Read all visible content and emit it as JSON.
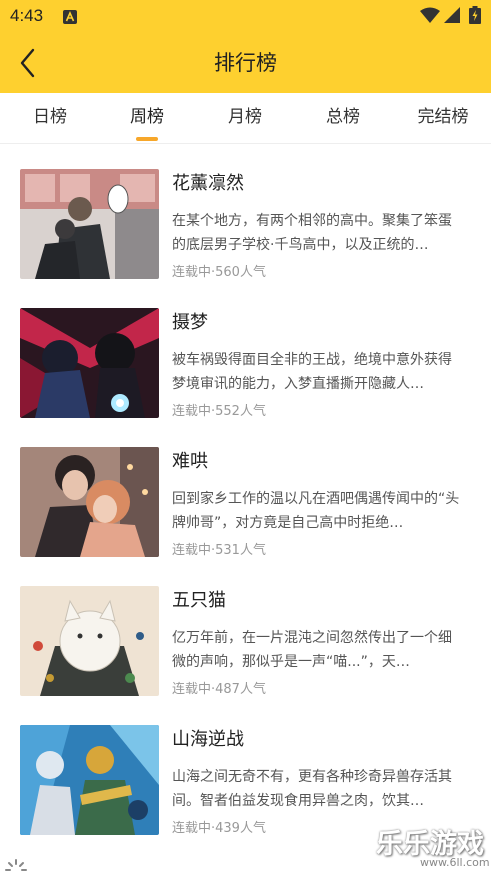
{
  "status_bar": {
    "time": "4:43"
  },
  "header": {
    "title": "排行榜"
  },
  "tabs": [
    {
      "label": "日榜"
    },
    {
      "label": "周榜"
    },
    {
      "label": "月榜"
    },
    {
      "label": "总榜"
    },
    {
      "label": "完结榜"
    }
  ],
  "active_tab": "周榜",
  "comics": [
    {
      "title": "花薰凛然",
      "desc": "在某个地方，有两个相邻的高中。聚集了笨蛋的底层男子学校·千鸟高中，以及正统的…",
      "meta": "连载中·560人气"
    },
    {
      "title": "摄梦",
      "desc": "被车祸毁得面目全非的王战，绝境中意外获得梦境审讯的能力，入梦直播撕开隐藏人…",
      "meta": "连载中·552人气"
    },
    {
      "title": "难哄",
      "desc": "回到家乡工作的温以凡在酒吧偶遇传闻中的“头牌帅哥”，对方竟是自己高中时拒绝…",
      "meta": "连载中·531人气"
    },
    {
      "title": "五只猫",
      "desc": "亿万年前，在一片混沌之间忽然传出了一个细微的声响，那似乎是一声“喵...”，天…",
      "meta": "连载中·487人气"
    },
    {
      "title": "山海逆战",
      "desc": "山海之间无奇不有，更有各种珍奇异兽存活其间。智者伯益发现食用异兽之肉，饮其…",
      "meta": "连载中·439人气"
    }
  ],
  "watermark": {
    "title": "乐乐游戏",
    "url": "www.6ll.com"
  },
  "colors": {
    "header_bg": "#FED02F",
    "tab_indicator": "#F7A72A"
  }
}
